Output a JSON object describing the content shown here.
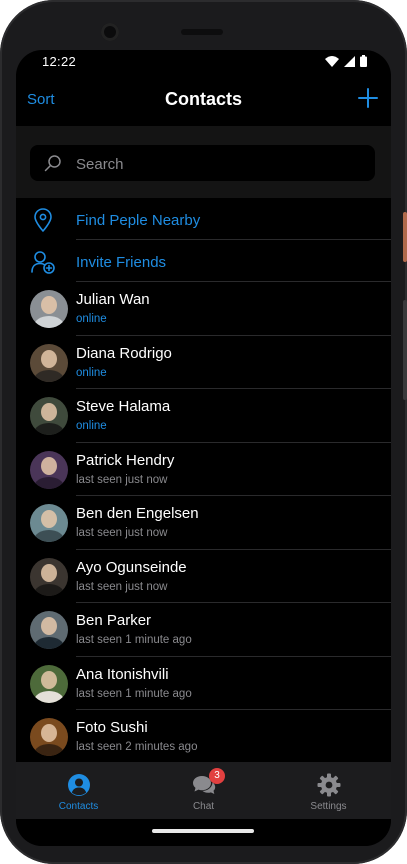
{
  "status_bar": {
    "time": "12:22"
  },
  "nav": {
    "sort_label": "Sort",
    "title": "Contacts",
    "add_icon": "plus-icon"
  },
  "search": {
    "placeholder": "Search"
  },
  "actions": [
    {
      "label": "Find Peple Nearby",
      "icon": "location-pin-icon"
    },
    {
      "label": "Invite Friends",
      "icon": "add-person-icon"
    }
  ],
  "contacts": [
    {
      "name": "Julian Wan",
      "status": "online",
      "online": true,
      "avatar_bg": "#8a8f94",
      "avatar_body": "#cfd3d6"
    },
    {
      "name": "Diana Rodrigo",
      "status": "online",
      "online": true,
      "avatar_bg": "#5b4a38",
      "avatar_body": "#2f2a25"
    },
    {
      "name": "Steve Halama",
      "status": "online",
      "online": true,
      "avatar_bg": "#3f4a3c",
      "avatar_body": "#1d1f1c"
    },
    {
      "name": "Patrick Hendry",
      "status": "last seen just now",
      "online": false,
      "avatar_bg": "#4a3558",
      "avatar_body": "#2a1d33"
    },
    {
      "name": "Ben den Engelsen",
      "status": "last seen just now",
      "online": false,
      "avatar_bg": "#6c8a92",
      "avatar_body": "#3d4f55"
    },
    {
      "name": "Ayo Ogunseinde",
      "status": "last seen just now",
      "online": false,
      "avatar_bg": "#3b3530",
      "avatar_body": "#1c1a18"
    },
    {
      "name": "Ben Parker",
      "status": "last seen 1 minute ago",
      "online": false,
      "avatar_bg": "#5f6b72",
      "avatar_body": "#1e2a33"
    },
    {
      "name": "Ana Itonishvili",
      "status": "last seen 1 minute ago",
      "online": false,
      "avatar_bg": "#4d6a3a",
      "avatar_body": "#e4e0d8"
    },
    {
      "name": "Foto Sushi",
      "status": "last seen 2 minutes ago",
      "online": false,
      "avatar_bg": "#7a4a1e",
      "avatar_body": "#3a2412"
    }
  ],
  "tabs": [
    {
      "label": "Contacts",
      "icon": "person-circle-icon",
      "active": true
    },
    {
      "label": "Chat",
      "icon": "chat-bubbles-icon",
      "active": false,
      "badge": "3"
    },
    {
      "label": "Settings",
      "icon": "gear-icon",
      "active": false
    }
  ],
  "colors": {
    "accent": "#1f8de2",
    "background": "#000000",
    "secondary_text": "#8a8a8e",
    "badge": "#e24040"
  }
}
